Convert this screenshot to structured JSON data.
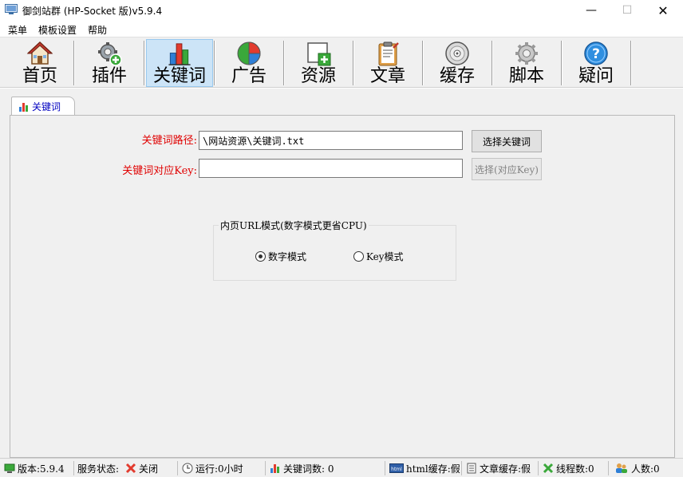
{
  "window": {
    "title": "御剑站群 (HP-Socket 版)v5.9.4",
    "minimize": "—",
    "maximize": "☐",
    "close": "✕"
  },
  "menu": [
    "菜单",
    "模板设置",
    "帮助"
  ],
  "toolbar": [
    {
      "label": "首页",
      "icon": "home-icon"
    },
    {
      "label": "插件",
      "icon": "plugin-gear-icon"
    },
    {
      "label": "关键词",
      "icon": "bar-chart-icon",
      "active": true
    },
    {
      "label": "广告",
      "icon": "pie-chart-icon"
    },
    {
      "label": "资源",
      "icon": "add-resource-icon"
    },
    {
      "label": "文章",
      "icon": "clipboard-icon"
    },
    {
      "label": "缓存",
      "icon": "disc-icon"
    },
    {
      "label": "脚本",
      "icon": "gear-icon"
    },
    {
      "label": "疑问",
      "icon": "help-icon"
    }
  ],
  "tab": {
    "label": "关键词"
  },
  "form": {
    "path_label": "关键词路径:",
    "path_value": "\\网站资源\\关键词.txt",
    "select_keyword_button": "选择关键词",
    "key_label": "关键词对应Key:",
    "key_value": "",
    "select_key_button": "选择(对应Key)"
  },
  "url_mode": {
    "title": "内页URL模式(数字模式更省CPU)",
    "options": [
      {
        "label": "数字模式",
        "checked": true
      },
      {
        "label": "Key模式",
        "checked": false
      }
    ]
  },
  "status": {
    "version": "版本:5.9.4",
    "service_label": "服务状态:",
    "service_value": "关闭",
    "runtime": "运行:0小时",
    "keyword_count": "关键词数: 0",
    "html_cache": "html缓存:假",
    "article_cache": "文章缓存:假",
    "threads": "线程数:0",
    "people": "人数:0"
  },
  "colors": {
    "accent_red": "#e00000",
    "tab_blue": "#0000c0",
    "active_bg": "#cce4f7"
  }
}
